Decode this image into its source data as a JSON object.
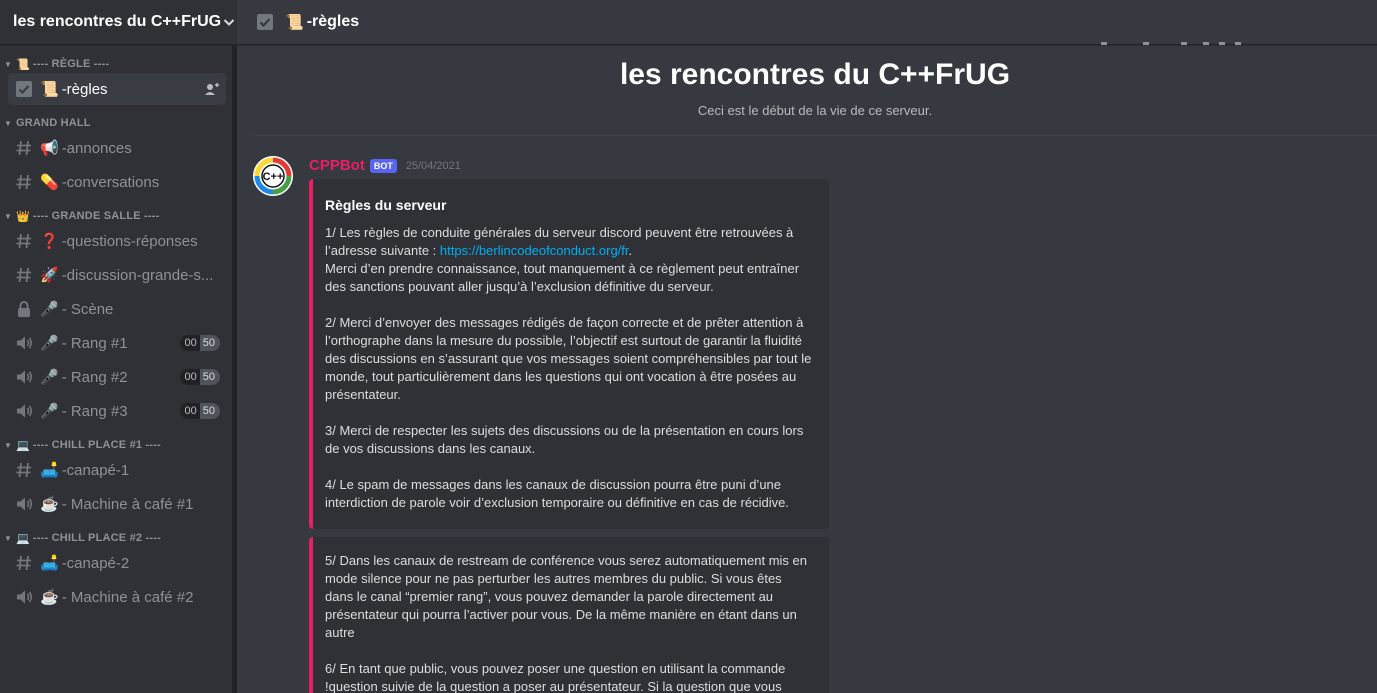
{
  "server": {
    "name": "les rencontres du C++FrUG"
  },
  "sidebar": {
    "categories": [
      {
        "emoji": "📜",
        "label": "---- RÈGLE ----",
        "channels": [
          {
            "type": "rules",
            "emoji": "📜",
            "name": "-règles",
            "active": true
          }
        ]
      },
      {
        "emoji": "",
        "label": "GRAND HALL",
        "channels": [
          {
            "type": "text",
            "emoji": "📢",
            "name": "-annonces"
          },
          {
            "type": "text",
            "emoji": "💊",
            "name": "-conversations"
          }
        ]
      },
      {
        "emoji": "👑",
        "label": "---- GRANDE SALLE ----",
        "channels": [
          {
            "type": "text",
            "emoji": "❓",
            "name": "-questions-réponses"
          },
          {
            "type": "text",
            "emoji": "🚀",
            "name": "-discussion-grande-s..."
          },
          {
            "type": "stage",
            "emoji": "🎤",
            "name": " - Scène"
          },
          {
            "type": "voice",
            "emoji": "🎤",
            "name": " - Rang #1",
            "count_a": "00",
            "count_b": "50"
          },
          {
            "type": "voice",
            "emoji": "🎤",
            "name": " - Rang #2",
            "count_a": "00",
            "count_b": "50"
          },
          {
            "type": "voice",
            "emoji": "🎤",
            "name": " - Rang #3",
            "count_a": "00",
            "count_b": "50"
          }
        ]
      },
      {
        "emoji": "💻",
        "label": "---- CHILL PLACE #1 ----",
        "channels": [
          {
            "type": "text",
            "emoji": "🛋️",
            "name": "-canapé-1"
          },
          {
            "type": "voice",
            "emoji": "☕",
            "name": "- Machine à café #1"
          }
        ]
      },
      {
        "emoji": "💻",
        "label": "---- CHILL PLACE #2 ----",
        "channels": [
          {
            "type": "text",
            "emoji": "🛋️",
            "name": "-canapé-2"
          },
          {
            "type": "voice",
            "emoji": "☕",
            "name": "- Machine à café #2"
          }
        ]
      }
    ]
  },
  "topbar": {
    "emoji": "📜",
    "title": "-règles"
  },
  "welcome": {
    "title": "les rencontres du C++FrUG",
    "subtitle": "Ceci est le début de la vie de ce serveur."
  },
  "message": {
    "author": "CPPBot",
    "tag": "BOT",
    "timestamp": "25/04/2021",
    "embed1": {
      "title": "Règles du serveur",
      "p1_before": "1/ Les règles de conduite générales du serveur discord peuvent être retrouvées à l’adresse suivante : ",
      "p1_link": "https://berlincodeofconduct.org/fr",
      "p1_after": ".",
      "p1_line2": "Merci d’en prendre connaissance, tout manquement à ce règlement peut entraîner des sanctions pouvant aller jusqu’à l’exclusion définitive du serveur.",
      "p2": "2/ Merci d’envoyer des messages rédigés de façon correcte et de prêter attention à l’orthographe dans la mesure du possible, l’objectif est surtout de garantir la fluidité des discussions en s’assurant que vos messages soient compréhensibles par tout le monde, tout particulièrement dans les questions qui ont vocation à être posées au présentateur.",
      "p3": "3/ Merci de respecter les sujets des discussions ou de la présentation en cours lors de vos discussions dans les canaux.",
      "p4": "4/ Le spam de messages dans les canaux de discussion pourra être puni d’une interdiction de parole voir d’exclusion temporaire ou définitive en cas de récidive."
    },
    "embed2": {
      "p5": "5/ Dans les canaux de restream de conférence vous serez automatiquement mis en mode silence pour ne pas perturber les autres membres du public. Si vous êtes dans le canal “premier rang”, vous pouvez demander la parole directement au présentateur qui pourra l’activer pour vous. De la même manière en étant dans un autre",
      "p6": "6/ En tant que public, vous pouvez poser une question en utilisant la commande !question suivie de la question a poser au présentateur. Si la question que vous"
    }
  },
  "colors": {
    "accent": "#e91e63",
    "link": "#00b0f4",
    "bot_tag": "#5865f2"
  }
}
